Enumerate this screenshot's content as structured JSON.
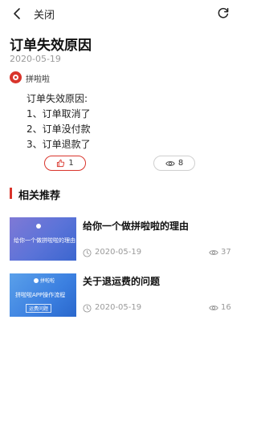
{
  "header": {
    "close_label": "关闭"
  },
  "article": {
    "title": "订单失效原因",
    "date": "2020-05-19",
    "author": "拼啦啦",
    "body": [
      "订单失效原因:",
      "1、订单取消了",
      "2、订单没付款",
      "3、订单退款了"
    ],
    "likes": "1",
    "views": "8"
  },
  "recommend": {
    "section_title": "相关推荐",
    "cards": [
      {
        "title": "给你一个做拼啦啦的理由",
        "date": "2020-05-19",
        "views": "37",
        "thumb_caption": "给你一个做拼啦啦的理由"
      },
      {
        "title": "关于退运费的问题",
        "date": "2020-05-19",
        "views": "16",
        "thumb_logo": "拼啦啦",
        "thumb_caption": "拼啦啦APP操作流程",
        "thumb_caption_sub": "运费问题"
      }
    ]
  },
  "colors": {
    "accent": "#d9342b",
    "muted": "#9a9a9a",
    "thumb_1": "#5a73d8",
    "thumb_2": "#3b7fe0"
  },
  "icons": [
    "chevron-left-icon",
    "refresh-icon",
    "thumbs-up-icon",
    "eye-icon",
    "clock-icon"
  ]
}
